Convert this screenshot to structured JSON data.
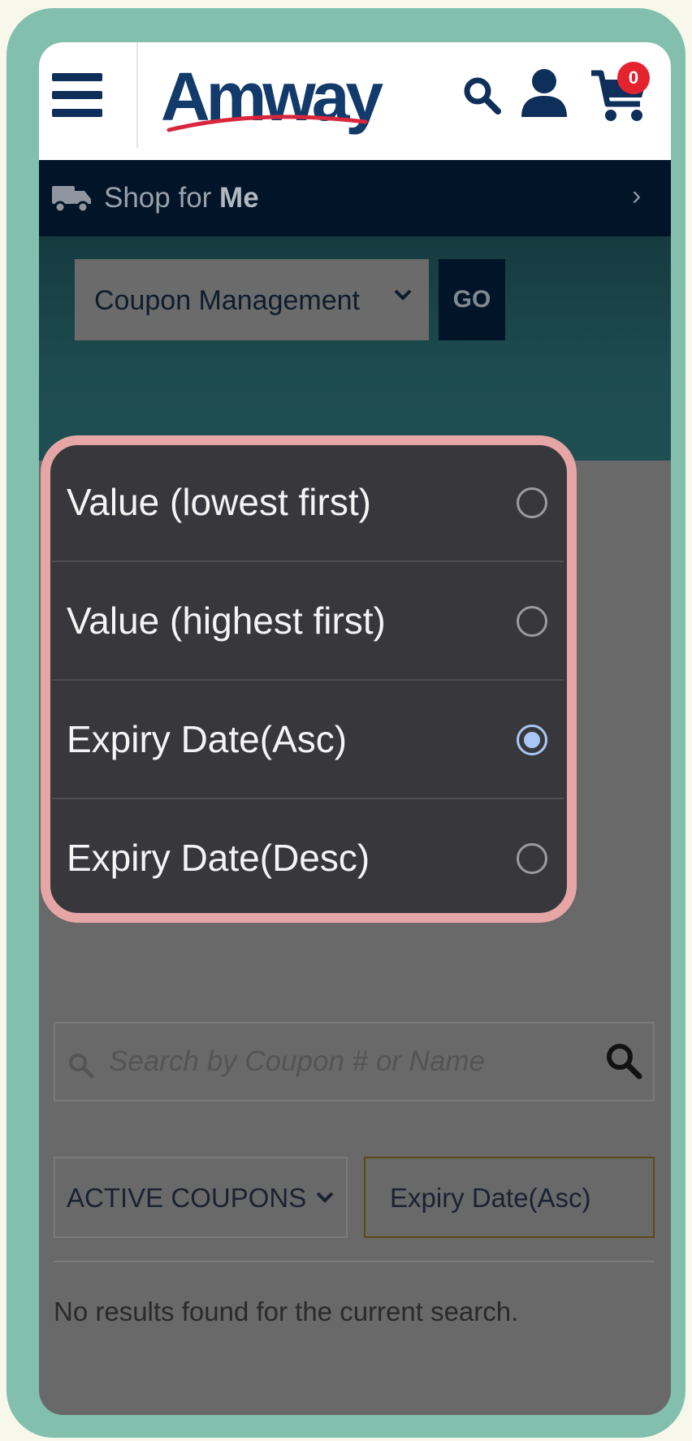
{
  "header": {
    "logo_text": "Amway",
    "cart_count": "0"
  },
  "shop_bar": {
    "prefix": "Shop for",
    "target": "Me",
    "chevron": "›"
  },
  "banner": {
    "select_value": "Coupon Management",
    "go_label": "GO"
  },
  "sort_dialog": {
    "options": [
      {
        "label": "Value (lowest first)",
        "selected": false
      },
      {
        "label": "Value (highest first)",
        "selected": false
      },
      {
        "label": "Expiry Date(Asc)",
        "selected": true
      },
      {
        "label": "Expiry Date(Desc)",
        "selected": false
      }
    ]
  },
  "search": {
    "placeholder": "Search by Coupon # or Name"
  },
  "filters": {
    "status_value": "ACTIVE COUPONS",
    "sort_value": "Expiry Date(Asc)"
  },
  "results": {
    "empty_message": "No results found for the current search."
  },
  "colors": {
    "frame": "#82c0ad",
    "brand_navy": "#123a6b",
    "shop_bar": "#011428",
    "cart_badge": "#e5232f",
    "highlight": "#e6a6a6",
    "radio_selected": "#a9c7f5"
  },
  "icons": [
    "menu-icon",
    "search-icon",
    "user-icon",
    "cart-icon",
    "truck-icon",
    "chevron-right-icon",
    "chevron-down-icon",
    "radio-icon"
  ]
}
